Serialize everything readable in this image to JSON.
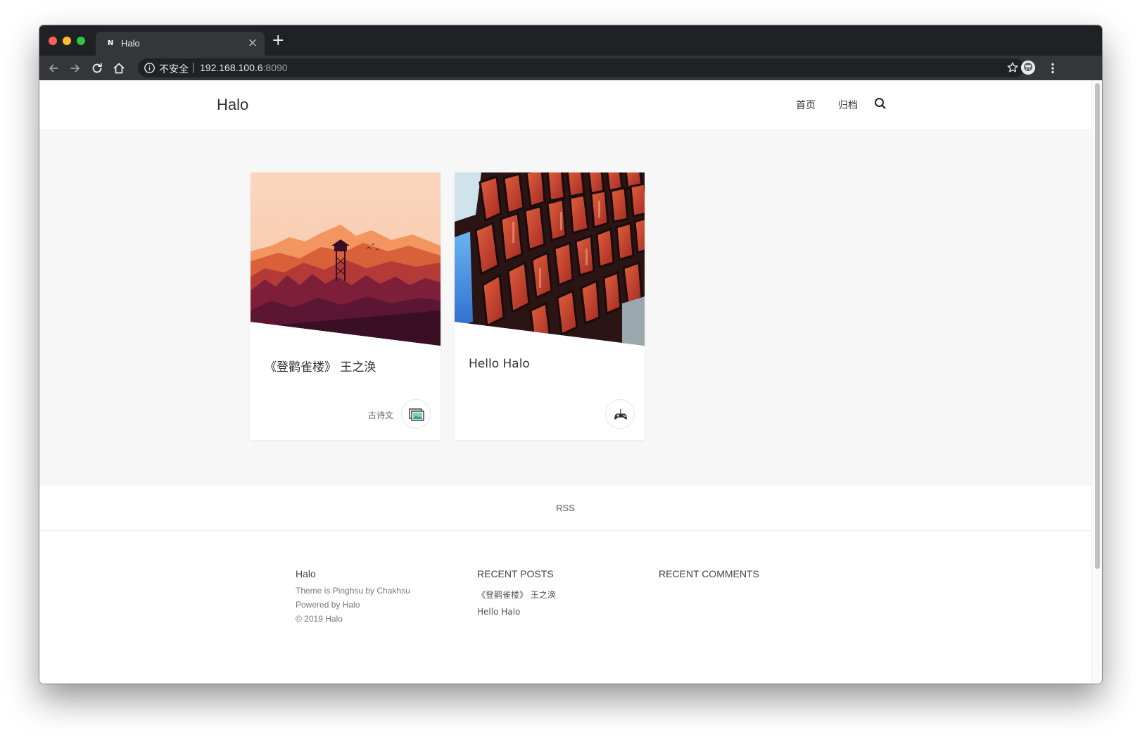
{
  "browser": {
    "tab_title": "Halo",
    "tab_favicon_letter": "N",
    "tab_close": "×",
    "new_tab": "+",
    "security_label": "不安全",
    "url_host": "192.168.100.6",
    "url_port": ":8090"
  },
  "site": {
    "brand": "Halo",
    "nav": [
      {
        "label": "首页"
      },
      {
        "label": "归档"
      }
    ]
  },
  "posts": [
    {
      "title": "《登鹳雀楼》 王之涣",
      "tag": "古诗文",
      "cover": "firewatch-landscape",
      "icon": "picture-icon"
    },
    {
      "title": "Hello Halo",
      "tag": "",
      "cover": "stained-glass-facade",
      "icon": "gamepad-icon"
    }
  ],
  "rss": "RSS",
  "footer": {
    "about": {
      "title": "Halo",
      "theme_line": "Theme is Pinghsu by Chakhsu",
      "powered_line": "Powered by Halo",
      "copyright_line": "© 2019 Halo"
    },
    "recent_posts": {
      "heading": "RECENT POSTS",
      "items": [
        "《登鹳雀楼》 王之涣",
        "Hello Halo"
      ]
    },
    "recent_comments": {
      "heading": "RECENT COMMENTS"
    }
  },
  "colors": {
    "chrome_dark": "#202124",
    "chrome_toolbar": "#35363a",
    "page_background": "#f7f7f7",
    "text_primary": "#333333"
  }
}
